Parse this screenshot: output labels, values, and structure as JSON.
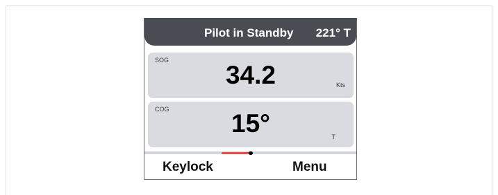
{
  "header": {
    "title": "Pilot in Standby",
    "heading": "221° T"
  },
  "tiles": [
    {
      "label": "SOG",
      "value": "34.2",
      "unit": "Kts"
    },
    {
      "label": "COG",
      "value": "15°",
      "unit": "T"
    }
  ],
  "softkeys": {
    "left": "Keylock",
    "right": "Menu"
  },
  "page_indicator": {
    "active_color": "#e84a4a"
  },
  "colors": {
    "header_bg": "#4a4c54",
    "tile_bg": "#dadbe1"
  }
}
